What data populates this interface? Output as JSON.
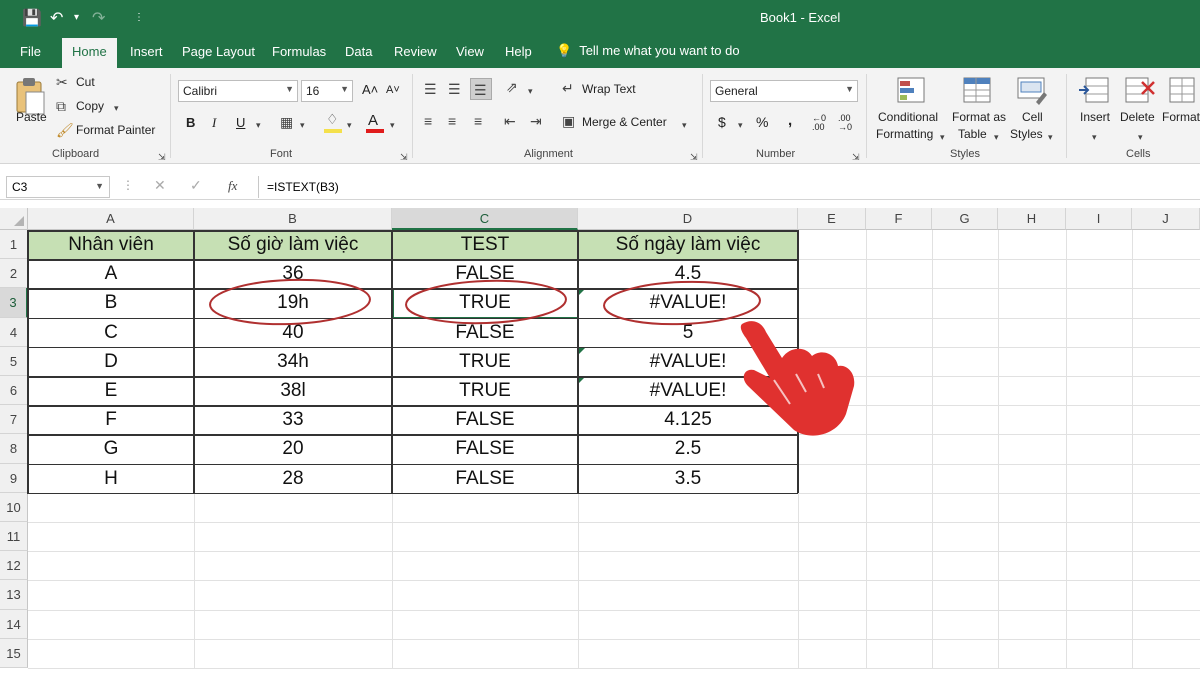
{
  "titlebar": {
    "title": "Book1  -  Excel"
  },
  "tabs": [
    "File",
    "Home",
    "Insert",
    "Page Layout",
    "Formulas",
    "Data",
    "Review",
    "View",
    "Help"
  ],
  "tell_me": "Tell me what you want to do",
  "clipboard": {
    "paste": "Paste",
    "cut": "Cut",
    "copy": "Copy",
    "format_painter": "Format Painter",
    "label": "Clipboard"
  },
  "font": {
    "name": "Calibri",
    "size": "16",
    "label": "Font",
    "bold": "B",
    "italic": "I",
    "underline": "U"
  },
  "alignment": {
    "wrap_text": "Wrap Text",
    "merge_center": "Merge & Center",
    "label": "Alignment"
  },
  "number": {
    "format": "General",
    "label": "Number",
    "currency": "$",
    "percent": "%",
    "comma": ","
  },
  "styles": {
    "conditional": "Conditional",
    "formatting": "Formatting",
    "format_as": "Format as",
    "table": "Table",
    "cell": "Cell",
    "styles_word": "Styles",
    "label": "Styles"
  },
  "cells": {
    "insert": "Insert",
    "delete": "Delete",
    "format": "Format",
    "label": "Cells"
  },
  "formula_bar": {
    "name_box": "C3",
    "fx": "fx",
    "formula": "=ISTEXT(B3)"
  },
  "columns": [
    "A",
    "B",
    "C",
    "D",
    "E",
    "F",
    "G",
    "H",
    "I",
    "J"
  ],
  "rows": [
    "1",
    "2",
    "3",
    "4",
    "5",
    "6",
    "7",
    "8",
    "9",
    "10",
    "11",
    "12",
    "13",
    "14",
    "15"
  ],
  "table": {
    "headers": [
      "Nhân viên",
      "Số giờ làm việc",
      "TEST",
      "Số ngày làm việc"
    ],
    "rows": [
      [
        "A",
        "36",
        "FALSE",
        "4.5"
      ],
      [
        "B",
        "19h",
        "TRUE",
        "#VALUE!"
      ],
      [
        "C",
        "40",
        "FALSE",
        "5"
      ],
      [
        "D",
        "34h",
        "TRUE",
        "#VALUE!"
      ],
      [
        "E",
        "38l",
        "TRUE",
        "#VALUE!"
      ],
      [
        "F",
        "33",
        "FALSE",
        "4.125"
      ],
      [
        "G",
        "20",
        "FALSE",
        "2.5"
      ],
      [
        "H",
        "28",
        "FALSE",
        "3.5"
      ]
    ]
  },
  "colors": {
    "excel_green": "#217346",
    "header_fill": "#c6e0b4",
    "annotation_red": "#b03030",
    "hand_red": "#e0312f"
  }
}
